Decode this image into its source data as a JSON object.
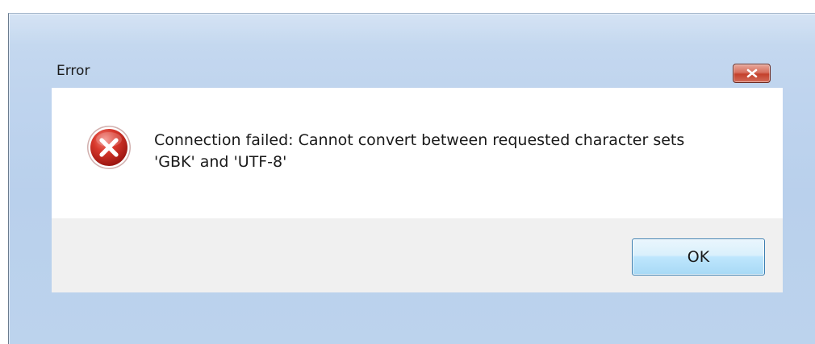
{
  "dialog": {
    "title": "Error",
    "message": "Connection failed: Cannot convert between requested character sets\n'GBK' and 'UTF-8'",
    "ok_label": "OK",
    "icon": "error-icon",
    "close_icon": "close-icon"
  },
  "colors": {
    "frame": "#bcd3ed",
    "close_button": "#c4412c",
    "ok_button_border": "#3c7fb1",
    "button_panel": "#f0f0f0",
    "error_icon": "#c5241b"
  }
}
